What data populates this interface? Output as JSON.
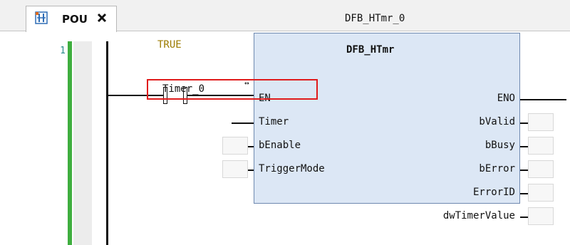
{
  "tab": {
    "title": "POU",
    "icon": "ladder-pou-icon",
    "close_icon": "close-icon"
  },
  "editor": {
    "line_number": "1",
    "instance_name": "DFB_HTmr_0",
    "contact_variable": "TRUE",
    "function_block": {
      "type_name": "DFB_HTmr",
      "inputs": [
        "EN",
        "Timer",
        "bEnable",
        "TriggerMode"
      ],
      "outputs": [
        "ENO",
        "bValid",
        "bBusy",
        "bError",
        "ErrorID",
        "dwTimerValue"
      ]
    },
    "timer_input_variable": "Timer_0",
    "link_arrow_glyph": "↔"
  },
  "colors": {
    "fb_fill": "#dce7f5",
    "fb_border": "#6f89b0",
    "contact_var_text": "#9c7b00",
    "gutter_green": "#3fae3f",
    "highlight": "#e01b1b"
  }
}
